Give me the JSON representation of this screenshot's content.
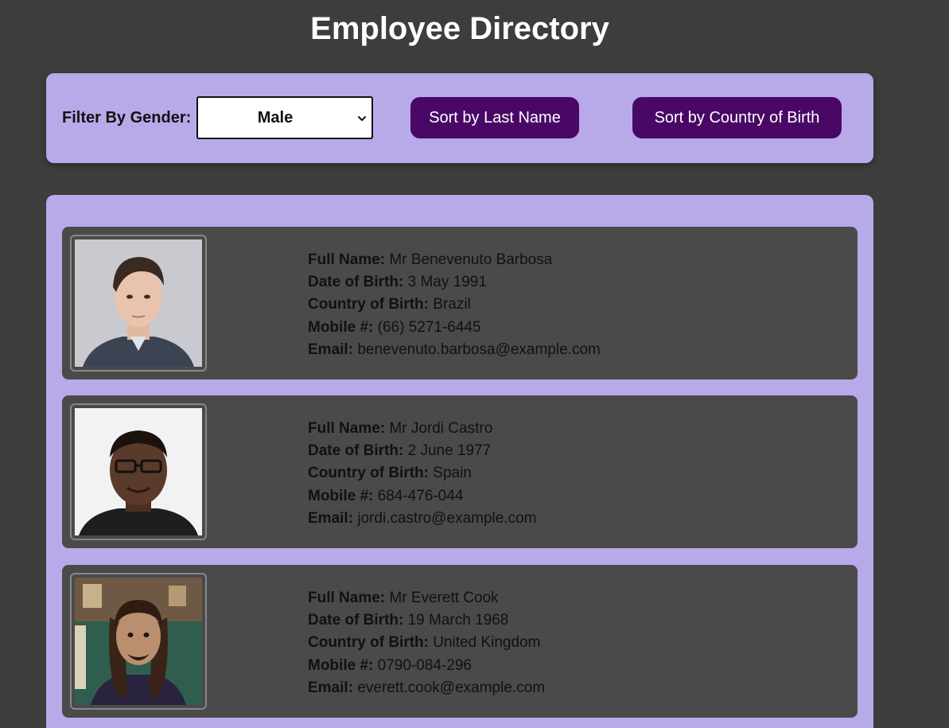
{
  "page": {
    "title": "Employee Directory"
  },
  "controls": {
    "filter_label": "Filter By Gender:",
    "gender_selected": "Male",
    "sort_last_name_label": "Sort by Last Name",
    "sort_country_label": "Sort by Country of Birth"
  },
  "field_labels": {
    "full_name": "Full Name:",
    "dob": "Date of Birth:",
    "country": "Country of Birth:",
    "mobile": "Mobile #:",
    "email": "Email:"
  },
  "employees": [
    {
      "full_name": "Mr Benevenuto Barbosa",
      "dob": "3 May 1991",
      "country": "Brazil",
      "mobile": "(66) 5271-6445",
      "email": "benevenuto.barbosa@example.com",
      "photo_icon": "portrait-photo"
    },
    {
      "full_name": "Mr Jordi Castro",
      "dob": "2 June 1977",
      "country": "Spain",
      "mobile": "684-476-044",
      "email": "jordi.castro@example.com",
      "photo_icon": "portrait-photo"
    },
    {
      "full_name": "Mr Everett Cook",
      "dob": "19 March 1968",
      "country": "United Kingdom",
      "mobile": "0790-084-296",
      "email": "everett.cook@example.com",
      "photo_icon": "portrait-photo"
    }
  ],
  "colors": {
    "background": "#3d3d3d",
    "panel": "#b8a9e9",
    "button": "#4a0866",
    "card": "#4a4a4a"
  }
}
